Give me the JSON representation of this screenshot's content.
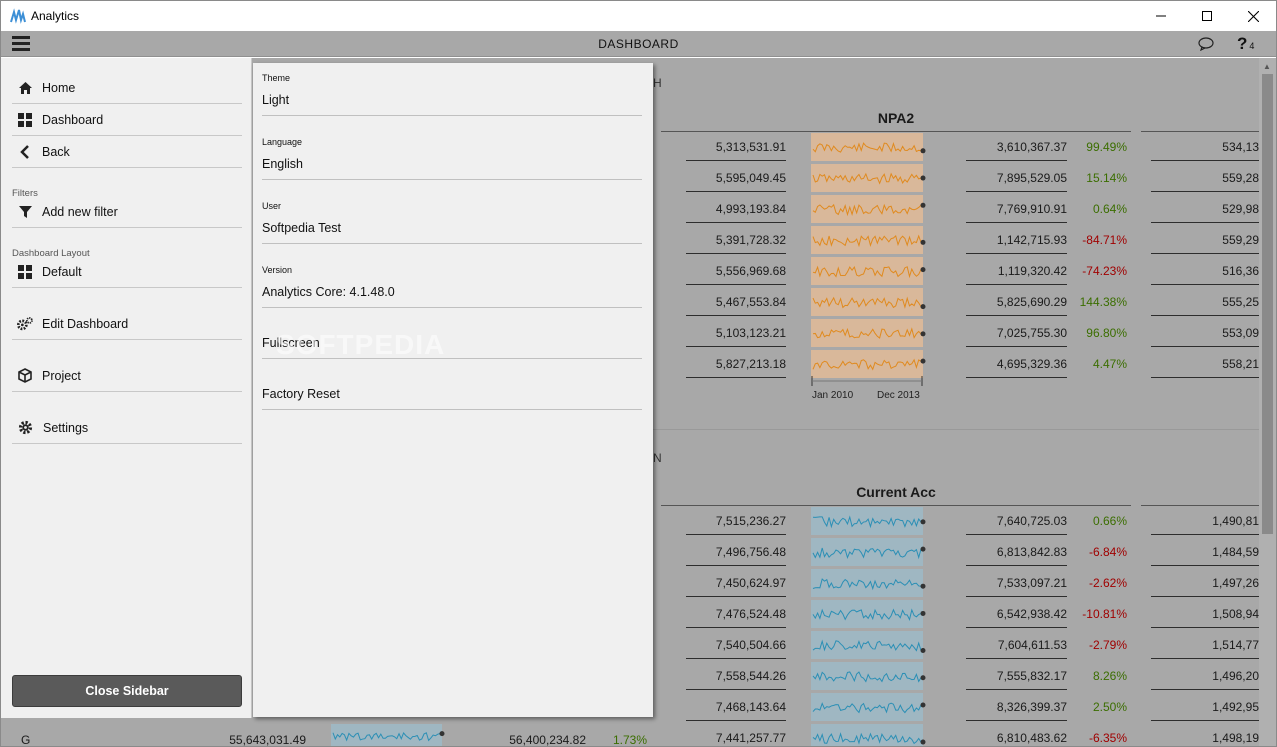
{
  "window": {
    "title": "Analytics"
  },
  "appbar": {
    "title": "DASHBOARD",
    "help_count": "4"
  },
  "menu": {
    "home": "Home",
    "dashboard": "Dashboard",
    "back": "Back",
    "filters_caption": "Filters",
    "add_filter": "Add new filter",
    "layout_caption": "Dashboard Layout",
    "default": "Default",
    "edit_dashboard": "Edit Dashboard",
    "project": "Project",
    "settings": "Settings",
    "close_sidebar": "Close Sidebar"
  },
  "settings_panel": {
    "theme_caption": "Theme",
    "theme_value": "Light",
    "language_caption": "Language",
    "language_value": "English",
    "user_caption": "User",
    "user_value": "Softpedia Test",
    "version_caption": "Version",
    "version_value": "Analytics Core: 4.1.48.0",
    "fullscreen": "Fullscreen",
    "factory_reset": "Factory Reset",
    "watermark": "SOFTPEDIA"
  },
  "chart1": {
    "title": "NPA2",
    "sparkline_color": "#e08a1e",
    "axis_start": "Jan 2010",
    "axis_end": "Dec 2013",
    "rows": [
      {
        "v1": "5,313,531.91",
        "v2": "3,610,367.37",
        "pct": "99.49%",
        "sign": "pos",
        "v3": "534,13"
      },
      {
        "v1": "5,595,049.45",
        "v2": "7,895,529.05",
        "pct": "15.14%",
        "sign": "pos",
        "v3": "559,28"
      },
      {
        "v1": "4,993,193.84",
        "v2": "7,769,910.91",
        "pct": "0.64%",
        "sign": "pos",
        "v3": "529,98"
      },
      {
        "v1": "5,391,728.32",
        "v2": "1,142,715.93",
        "pct": "-84.71%",
        "sign": "neg",
        "v3": "559,29"
      },
      {
        "v1": "5,556,969.68",
        "v2": "1,119,320.42",
        "pct": "-74.23%",
        "sign": "neg",
        "v3": "516,36"
      },
      {
        "v1": "5,467,553.84",
        "v2": "5,825,690.29",
        "pct": "144.38%",
        "sign": "pos",
        "v3": "555,25"
      },
      {
        "v1": "5,103,123.21",
        "v2": "7,025,755.30",
        "pct": "96.80%",
        "sign": "pos",
        "v3": "553,09"
      },
      {
        "v1": "5,827,213.18",
        "v2": "4,695,329.36",
        "pct": "4.47%",
        "sign": "pos",
        "v3": "558,21"
      }
    ]
  },
  "chart2": {
    "title": "Current Acc",
    "sparkline_color": "#2b8fb5",
    "rows": [
      {
        "v1": "7,515,236.27",
        "v2": "7,640,725.03",
        "pct": "0.66%",
        "sign": "pos",
        "v3": "1,490,81"
      },
      {
        "v1": "7,496,756.48",
        "v2": "6,813,842.83",
        "pct": "-6.84%",
        "sign": "neg",
        "v3": "1,484,59"
      },
      {
        "v1": "7,450,624.97",
        "v2": "7,533,097.21",
        "pct": "-2.62%",
        "sign": "neg",
        "v3": "1,497,26"
      },
      {
        "v1": "7,476,524.48",
        "v2": "6,542,938.42",
        "pct": "-10.81%",
        "sign": "neg",
        "v3": "1,508,94"
      },
      {
        "v1": "7,540,504.66",
        "v2": "7,604,611.53",
        "pct": "-2.79%",
        "sign": "neg",
        "v3": "1,514,77"
      },
      {
        "v1": "7,558,544.26",
        "v2": "7,555,832.17",
        "pct": "8.26%",
        "sign": "pos",
        "v3": "1,496,20"
      },
      {
        "v1": "7,468,143.64",
        "v2": "8,326,399.37",
        "pct": "2.50%",
        "sign": "pos",
        "v3": "1,492,95"
      },
      {
        "v1": "7,441,257.77",
        "v2": "6,810,483.62",
        "pct": "-6.35%",
        "sign": "neg",
        "v3": "1,498,19"
      }
    ]
  },
  "bottom_row": {
    "label": "G",
    "v1": "55,643,031.49",
    "v2": "56,400,234.82",
    "pct": "1.73%"
  }
}
